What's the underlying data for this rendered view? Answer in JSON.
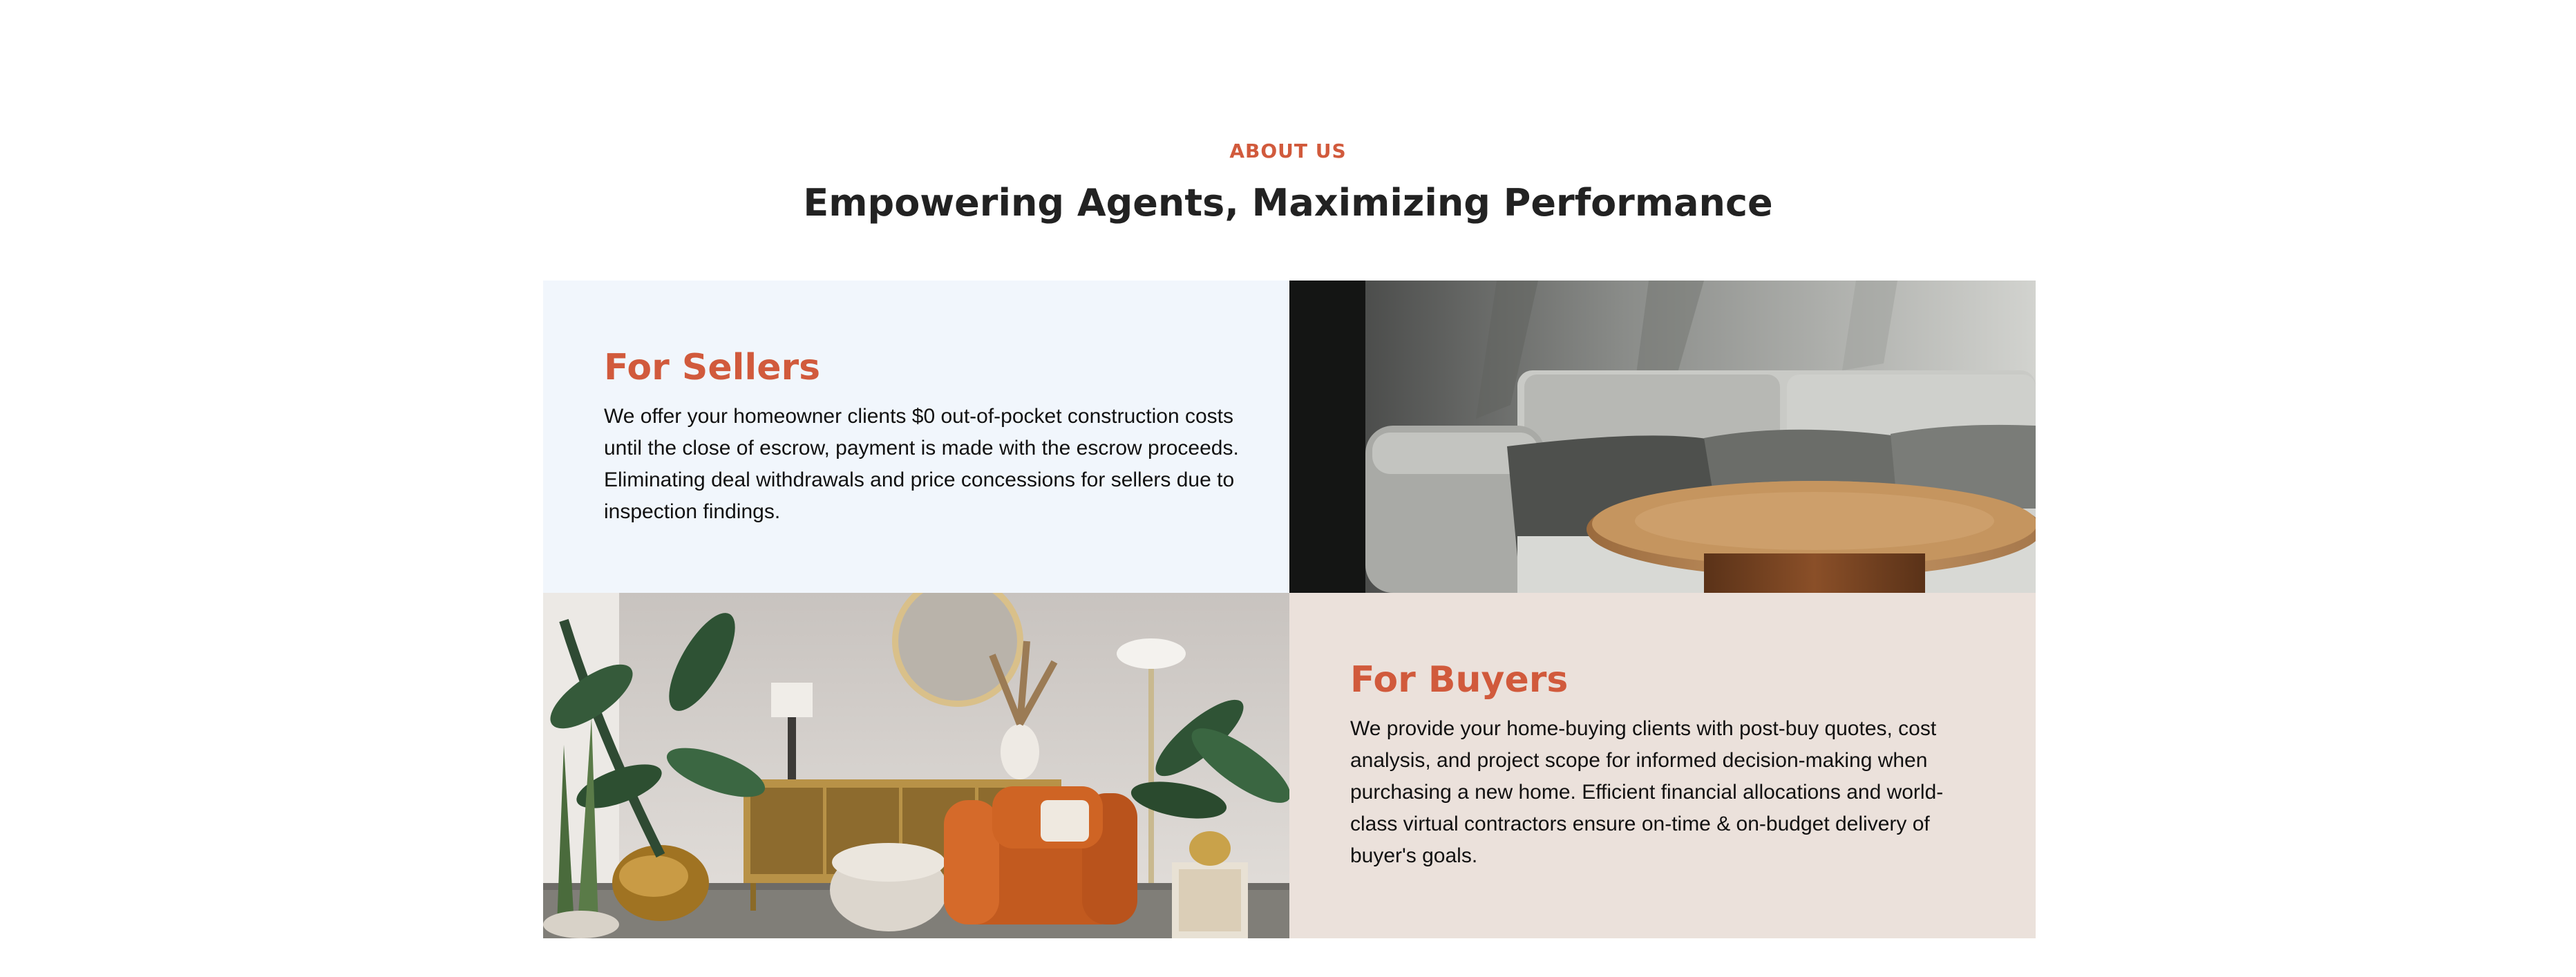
{
  "about": {
    "eyebrow": "ABOUT US",
    "heading": "Empowering Agents, Maximizing Performance"
  },
  "sellers": {
    "title": "For Sellers",
    "text": "We offer your homeowner clients $0 out-of-pocket construction costs until the close of escrow, payment is made with the escrow proceeds. Eliminating deal withdrawals and price concessions for sellers due to inspection findings."
  },
  "buyers": {
    "title": "For Buyers",
    "text": "We provide your home-buying clients with post-buy quotes, cost analysis, and project scope for informed decision-making when purchasing a new home. Efficient financial allocations and world-class virtual contractors ensure on-time & on-budget delivery of buyer's goals."
  },
  "colors": {
    "accent": "#d15a3c",
    "sellers_bg": "#f1f6fc",
    "buyers_bg": "#ebe1db",
    "heading": "#222222"
  }
}
